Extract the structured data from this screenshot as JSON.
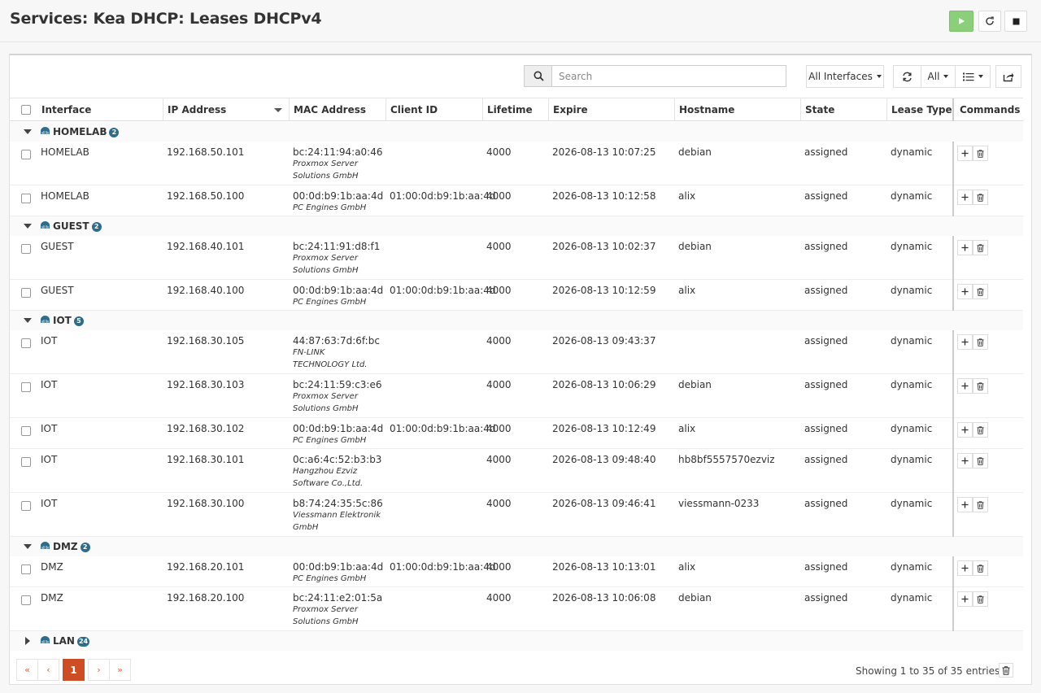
{
  "page": {
    "title": "Services: Kea DHCP: Leases DHCPv4"
  },
  "service_controls": {
    "start": "play-icon",
    "restart": "reload-icon",
    "stop": "stop-icon"
  },
  "toolbar": {
    "search_placeholder": "Search",
    "interfaces_label": "All Interfaces",
    "rows_label": "All"
  },
  "columns": [
    "Interface",
    "IP Address",
    "MAC Address",
    "Client ID",
    "Lifetime",
    "Expire",
    "Hostname",
    "State",
    "Lease Type",
    "Commands"
  ],
  "groups": [
    {
      "name": "HOMELAB",
      "count": "2",
      "expanded": true,
      "rows": [
        {
          "iface": "HOMELAB",
          "ip": "192.168.50.101",
          "mac": "bc:24:11:94:a0:46",
          "vendor": "Proxmox Server Solutions GmbH",
          "client_id": "",
          "lifetime": "4000",
          "expire": "2026-08-13 10:07:25",
          "hostname": "debian",
          "state": "assigned",
          "type": "dynamic"
        },
        {
          "iface": "HOMELAB",
          "ip": "192.168.50.100",
          "mac": "00:0d:b9:1b:aa:4d",
          "vendor": "PC Engines GmbH",
          "client_id": "01:00:0d:b9:1b:aa:4d",
          "lifetime": "4000",
          "expire": "2026-08-13 10:12:58",
          "hostname": "alix",
          "state": "assigned",
          "type": "dynamic"
        }
      ]
    },
    {
      "name": "GUEST",
      "count": "2",
      "expanded": true,
      "rows": [
        {
          "iface": "GUEST",
          "ip": "192.168.40.101",
          "mac": "bc:24:11:91:d8:f1",
          "vendor": "Proxmox Server Solutions GmbH",
          "client_id": "",
          "lifetime": "4000",
          "expire": "2026-08-13 10:02:37",
          "hostname": "debian",
          "state": "assigned",
          "type": "dynamic"
        },
        {
          "iface": "GUEST",
          "ip": "192.168.40.100",
          "mac": "00:0d:b9:1b:aa:4d",
          "vendor": "PC Engines GmbH",
          "client_id": "01:00:0d:b9:1b:aa:4d",
          "lifetime": "4000",
          "expire": "2026-08-13 10:12:59",
          "hostname": "alix",
          "state": "assigned",
          "type": "dynamic"
        }
      ]
    },
    {
      "name": "IOT",
      "count": "5",
      "expanded": true,
      "rows": [
        {
          "iface": "IOT",
          "ip": "192.168.30.105",
          "mac": "44:87:63:7d:6f:bc",
          "vendor": "FN-LINK TECHNOLOGY Ltd.",
          "client_id": "",
          "lifetime": "4000",
          "expire": "2026-08-13 09:43:37",
          "hostname": "",
          "state": "assigned",
          "type": "dynamic"
        },
        {
          "iface": "IOT",
          "ip": "192.168.30.103",
          "mac": "bc:24:11:59:c3:e6",
          "vendor": "Proxmox Server Solutions GmbH",
          "client_id": "",
          "lifetime": "4000",
          "expire": "2026-08-13 10:06:29",
          "hostname": "debian",
          "state": "assigned",
          "type": "dynamic"
        },
        {
          "iface": "IOT",
          "ip": "192.168.30.102",
          "mac": "00:0d:b9:1b:aa:4d",
          "vendor": "PC Engines GmbH",
          "client_id": "01:00:0d:b9:1b:aa:4d",
          "lifetime": "4000",
          "expire": "2026-08-13 10:12:49",
          "hostname": "alix",
          "state": "assigned",
          "type": "dynamic"
        },
        {
          "iface": "IOT",
          "ip": "192.168.30.101",
          "mac": "0c:a6:4c:52:b3:b3",
          "vendor": "Hangzhou Ezviz Software Co.,Ltd.",
          "client_id": "",
          "lifetime": "4000",
          "expire": "2026-08-13 09:48:40",
          "hostname": "hb8bf5557570ezviz",
          "state": "assigned",
          "type": "dynamic"
        },
        {
          "iface": "IOT",
          "ip": "192.168.30.100",
          "mac": "b8:74:24:35:5c:86",
          "vendor": "Viessmann Elektronik GmbH",
          "client_id": "",
          "lifetime": "4000",
          "expire": "2026-08-13 09:46:41",
          "hostname": "viessmann-0233",
          "state": "assigned",
          "type": "dynamic"
        }
      ]
    },
    {
      "name": "DMZ",
      "count": "2",
      "expanded": true,
      "rows": [
        {
          "iface": "DMZ",
          "ip": "192.168.20.101",
          "mac": "00:0d:b9:1b:aa:4d",
          "vendor": "PC Engines GmbH",
          "client_id": "01:00:0d:b9:1b:aa:4d",
          "lifetime": "4000",
          "expire": "2026-08-13 10:13:01",
          "hostname": "alix",
          "state": "assigned",
          "type": "dynamic"
        },
        {
          "iface": "DMZ",
          "ip": "192.168.20.100",
          "mac": "bc:24:11:e2:01:5a",
          "vendor": "Proxmox Server Solutions GmbH",
          "client_id": "",
          "lifetime": "4000",
          "expire": "2026-08-13 10:06:08",
          "hostname": "debian",
          "state": "assigned",
          "type": "dynamic"
        }
      ]
    },
    {
      "name": "LAN",
      "count": "24",
      "expanded": false,
      "rows": []
    }
  ],
  "pagination": {
    "first": "«",
    "prev": "‹",
    "current": "1",
    "next": "›",
    "last": "»"
  },
  "footer": {
    "showing": "Showing 1 to 35 of 35 entries"
  },
  "colors": {
    "accent": "#cf4d22",
    "start_button": "#8ccf7b",
    "badge": "#2e6c8c"
  }
}
